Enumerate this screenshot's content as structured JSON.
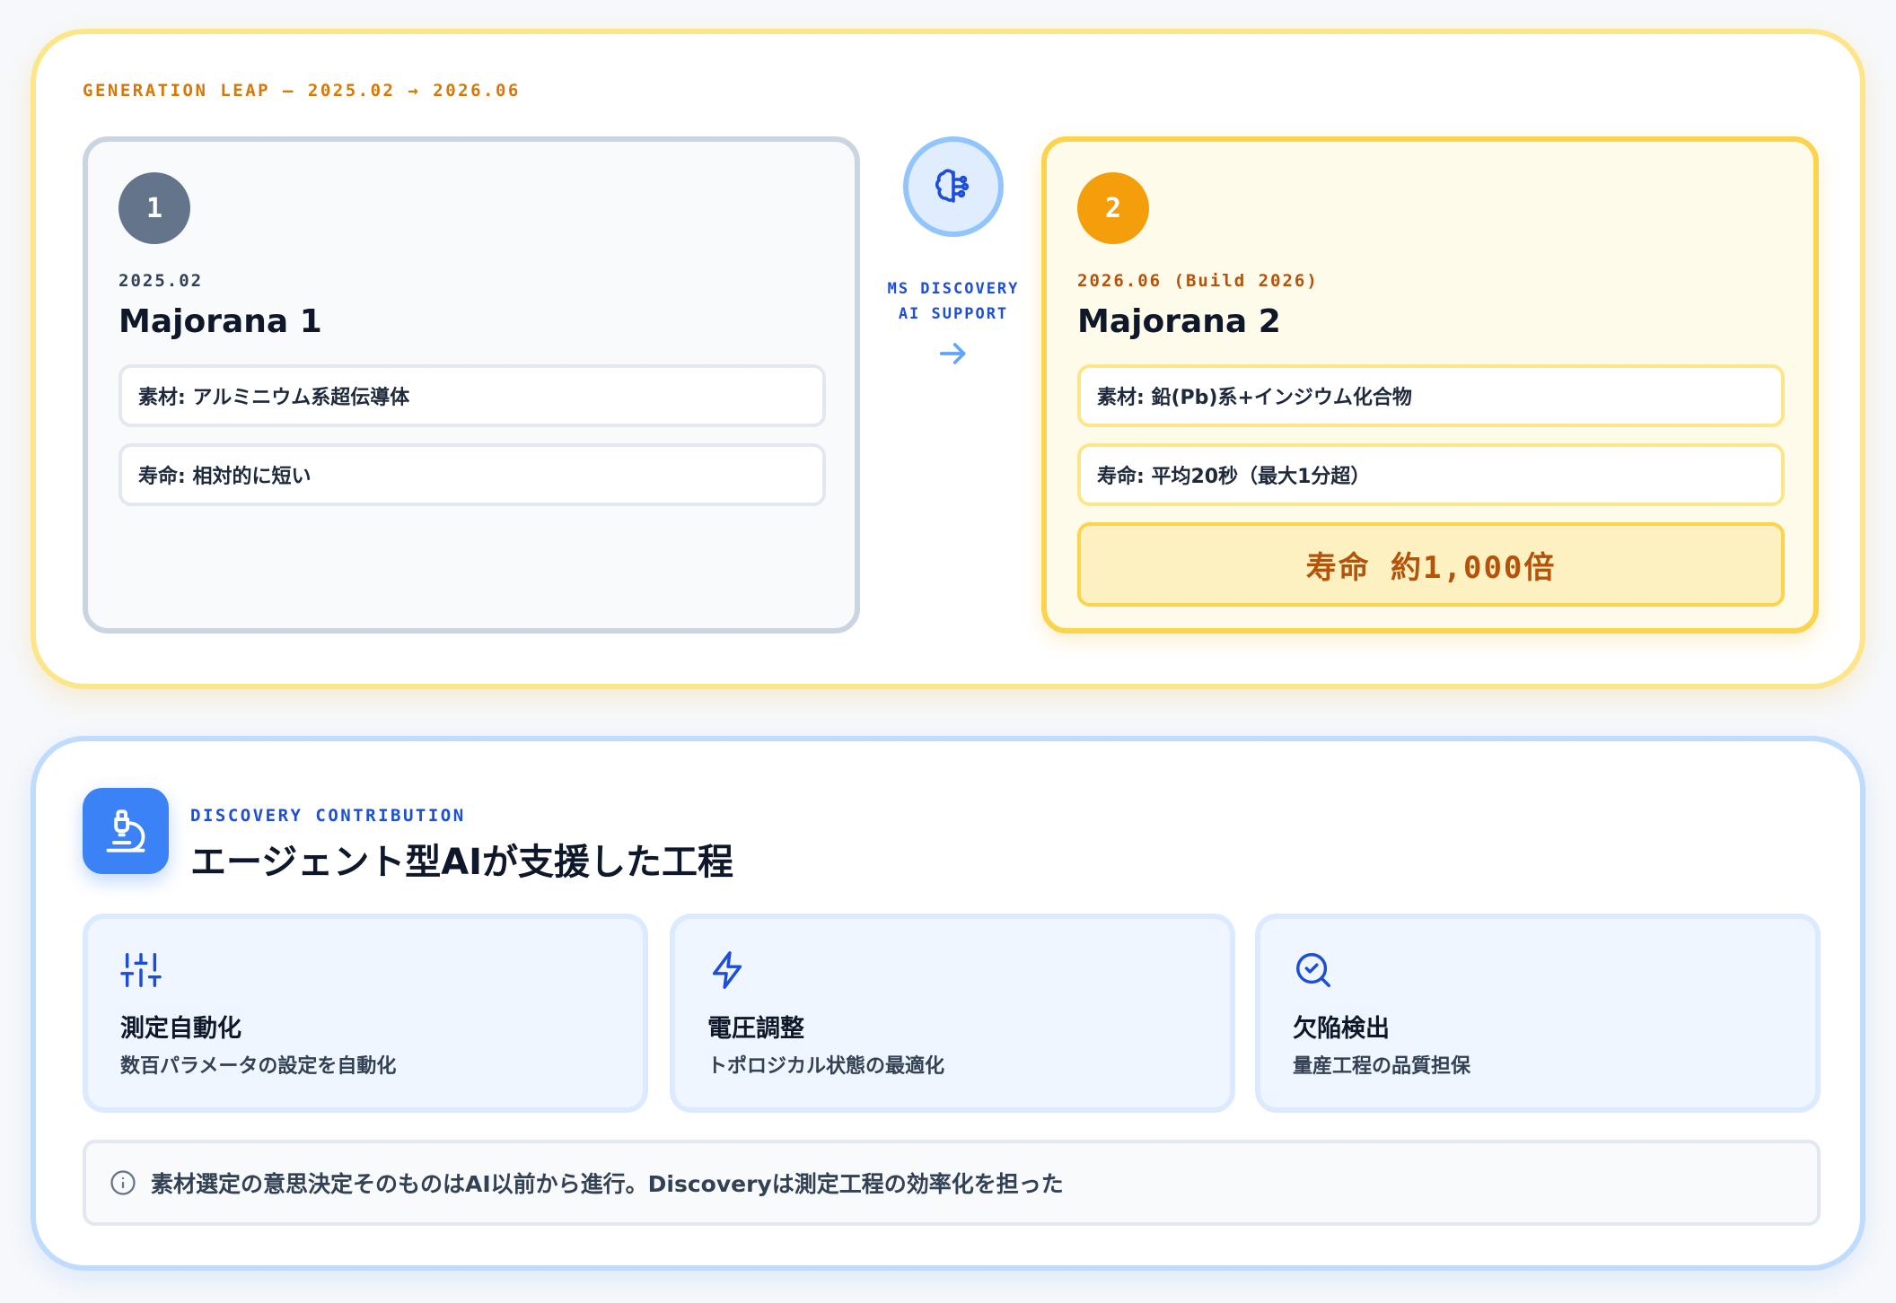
{
  "generation": {
    "eyebrow": "GENERATION LEAP — 2025.02 → 2026.06",
    "old": {
      "step": "1",
      "date": "2025.02",
      "name": "Majorana 1",
      "material": "素材: アルミニウム系超伝導体",
      "lifetime": "寿命: 相対的に短い"
    },
    "new": {
      "step": "2",
      "date": "2026.06 (Build 2026)",
      "name": "Majorana 2",
      "material": "素材: 鉛(Pb)系+インジウム化合物",
      "lifetime": "寿命: 平均20秒（最大1分超）",
      "highlight": "寿命 約1,000倍"
    },
    "connector": {
      "icon": "brain-icon",
      "label_line1": "MS DISCOVERY",
      "label_line2": "AI SUPPORT",
      "arrow": "arrow-right-icon"
    }
  },
  "discovery": {
    "icon": "microscope-icon",
    "eyebrow": "DISCOVERY CONTRIBUTION",
    "title": "エージェント型AIが支援した工程",
    "steps": [
      {
        "icon": "sliders-icon",
        "title": "測定自動化",
        "desc": "数百パラメータの設定を自動化"
      },
      {
        "icon": "lightning-icon",
        "title": "電圧調整",
        "desc": "トポロジカル状態の最適化"
      },
      {
        "icon": "search-check-icon",
        "title": "欠陥検出",
        "desc": "量産工程の品質担保"
      }
    ],
    "note": {
      "icon": "info-icon",
      "text": "素材選定の意思決定そのものはAI以前から進行。Discoveryは測定工程の効率化を担った"
    }
  },
  "colors": {
    "gold_accent": "#d97706",
    "gold_border": "#fde68a",
    "blue_accent": "#3b82f6",
    "blue_border": "#bfdbfe",
    "slate": "#64748b",
    "amber": "#f59e0b"
  }
}
